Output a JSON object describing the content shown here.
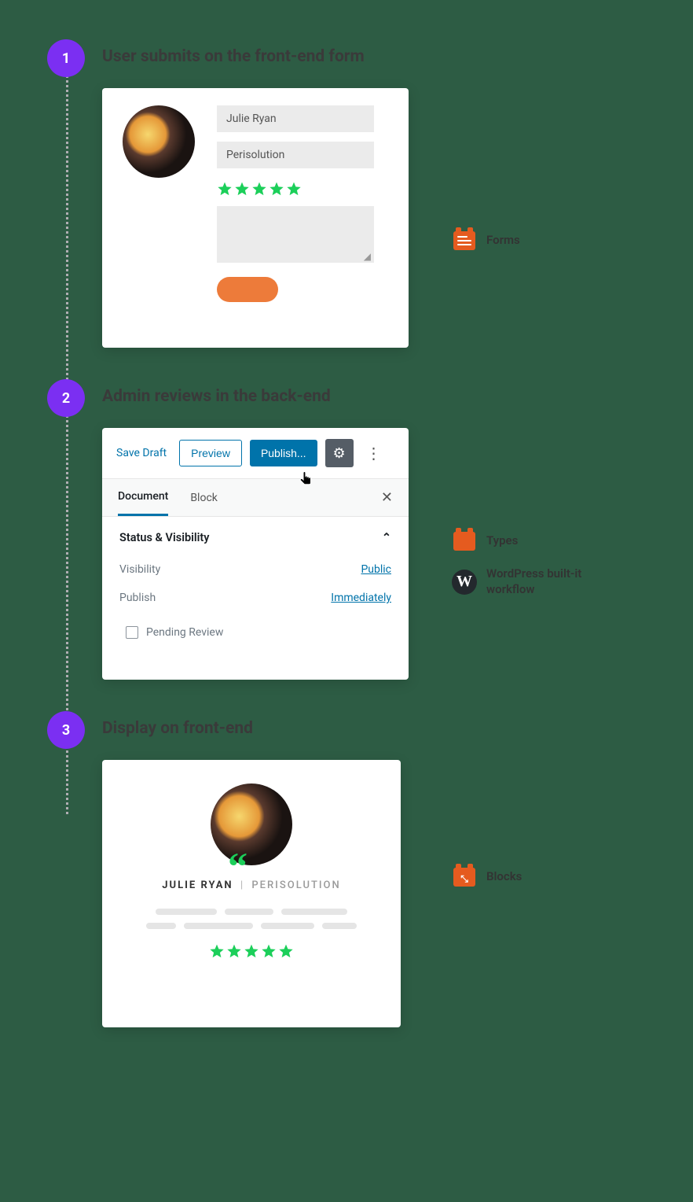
{
  "steps": [
    {
      "num": "1",
      "title": "User submits on the front-end form",
      "side": [
        {
          "icon": "form",
          "label": "Forms"
        }
      ],
      "form": {
        "name": "Julie Ryan",
        "company": "Perisolution",
        "rating": 5
      }
    },
    {
      "num": "2",
      "title": "Admin reviews in the back-end",
      "side": [
        {
          "icon": "plain",
          "label": "Types"
        },
        {
          "icon": "wp",
          "label": "WordPress built-it workflow"
        }
      ],
      "admin": {
        "save_draft": "Save Draft",
        "preview": "Preview",
        "publish": "Publish...",
        "tabs": {
          "document": "Document",
          "block": "Block"
        },
        "panel_title": "Status & Visibility",
        "visibility_label": "Visibility",
        "visibility_value": "Public",
        "publish_label": "Publish",
        "publish_value": "Immediately",
        "pending": "Pending Review"
      }
    },
    {
      "num": "3",
      "title": "Display on  front-end",
      "side": [
        {
          "icon": "arrows",
          "label": "Blocks"
        }
      ],
      "display": {
        "name": "JULIE RYAN",
        "sep": "|",
        "org": "PERISOLUTION",
        "rating": 5
      }
    }
  ]
}
